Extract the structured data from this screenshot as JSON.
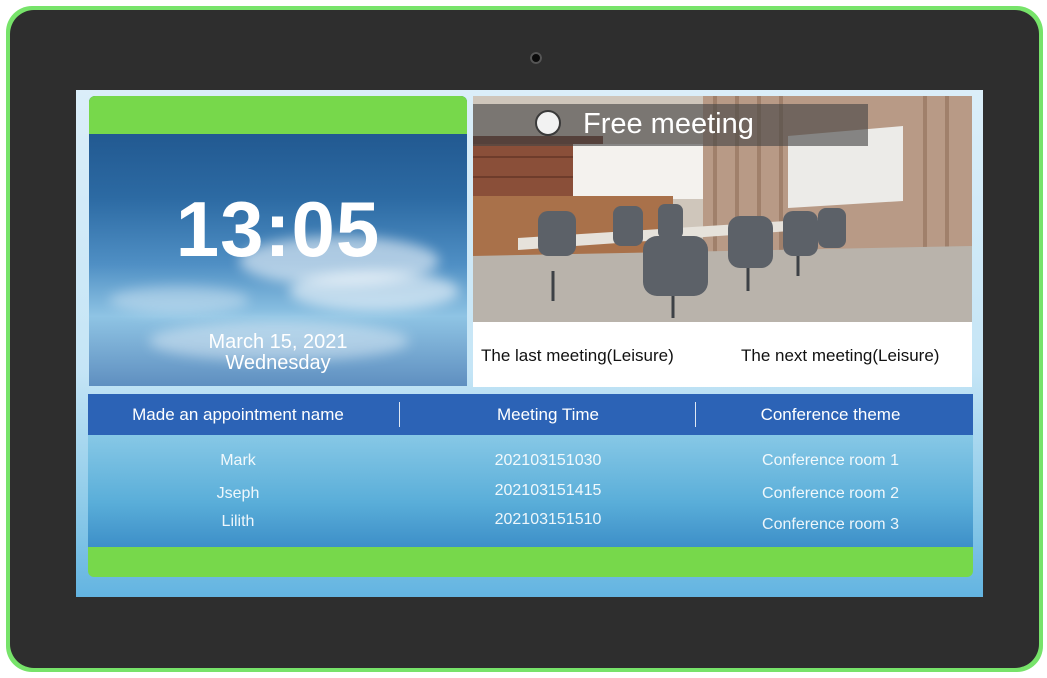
{
  "clock": {
    "time": "13:05",
    "date": "March 15, 2021",
    "weekday": "Wednesday"
  },
  "meeting": {
    "status": "Free meeting",
    "last_meeting": "The last meeting(Leisure)",
    "next_meeting": "The next meeting(Leisure)"
  },
  "table": {
    "headers": [
      "Made an appointment name",
      "Meeting Time",
      "Conference theme"
    ],
    "rows": [
      [
        "Mark",
        "202103151030",
        "Conference room 1"
      ],
      [
        "Jseph",
        "202103151415",
        "Conference room 2"
      ],
      [
        "Lilith",
        "202103151510",
        "Conference room 3"
      ]
    ]
  },
  "colors": {
    "accent_green": "#77d84b",
    "header_blue": "#2c63b6",
    "bezel": "#2e2e2e"
  }
}
